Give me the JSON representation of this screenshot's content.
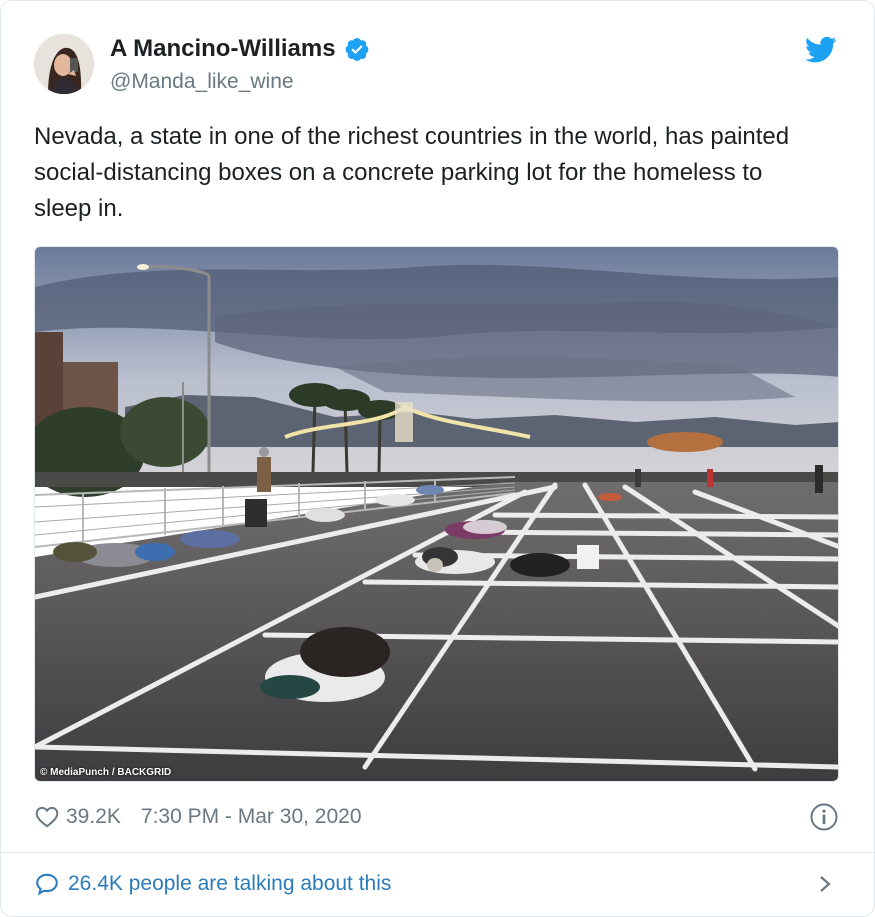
{
  "author": {
    "display_name": "A Mancino-Williams",
    "handle": "@Manda_like_wine",
    "verified": true,
    "avatar_icon": "profile-photo"
  },
  "tweet": {
    "text": "Nevada, a state in one of the richest countries in the world, has painted social-distancing boxes on a concrete parking lot for the homeless to sleep in."
  },
  "media": {
    "credit": "© MediaPunch / BACKGRID"
  },
  "meta": {
    "likes": "39.2K",
    "timestamp": "7:30 PM - Mar 30, 2020"
  },
  "footer": {
    "talking_label": "26.4K people are talking about this"
  },
  "colors": {
    "twitter_blue": "#1da1f2",
    "link_blue": "#2b7bb9",
    "meta_gray": "#697882",
    "text": "#1c2022"
  },
  "icons": {
    "verified": "verified-badge-icon",
    "brand": "twitter-bird-icon",
    "like": "heart-icon",
    "info": "info-icon",
    "conversation": "speech-bubble-icon",
    "more": "chevron-right-icon"
  }
}
